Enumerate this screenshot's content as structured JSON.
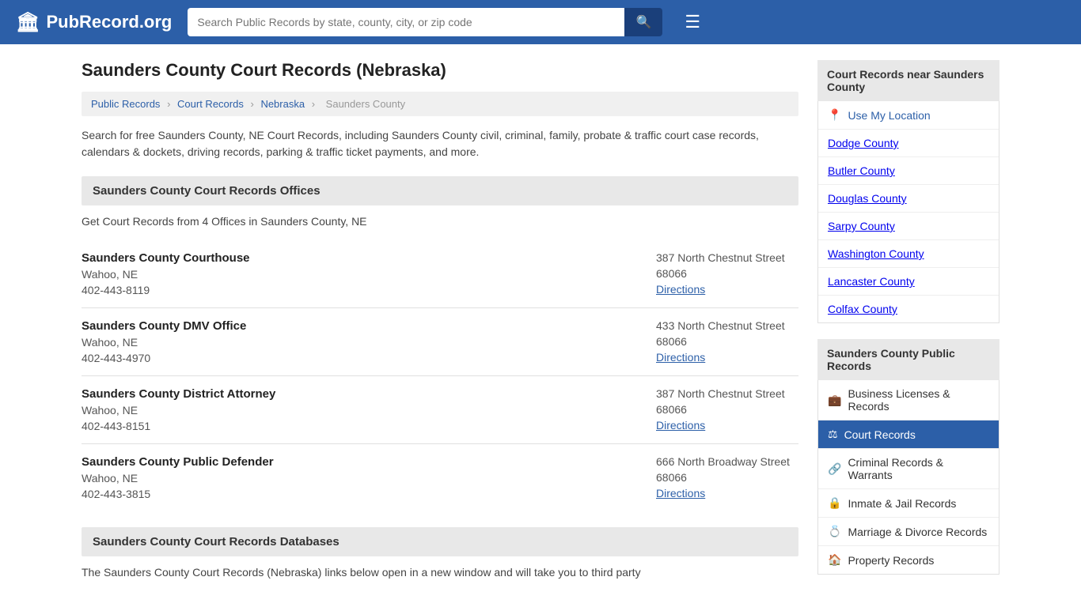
{
  "header": {
    "logo_icon": "🏛",
    "logo_text": "PubRecord.org",
    "search_placeholder": "Search Public Records by state, county, city, or zip code",
    "search_icon": "🔍"
  },
  "page": {
    "title": "Saunders County Court Records (Nebraska)",
    "description": "Search for free Saunders County, NE Court Records, including Saunders County civil, criminal, family, probate & traffic court case records, calendars & dockets, driving records, parking & traffic ticket payments, and more."
  },
  "breadcrumb": {
    "items": [
      "Public Records",
      "Court Records",
      "Nebraska",
      "Saunders County"
    ]
  },
  "offices_section": {
    "header": "Saunders County Court Records Offices",
    "sub_description": "Get Court Records from 4 Offices in Saunders County, NE",
    "offices": [
      {
        "name": "Saunders County Courthouse",
        "city": "Wahoo, NE",
        "phone": "402-443-8119",
        "address": "387 North Chestnut Street",
        "zip": "68066",
        "directions_label": "Directions"
      },
      {
        "name": "Saunders County DMV Office",
        "city": "Wahoo, NE",
        "phone": "402-443-4970",
        "address": "433 North Chestnut Street",
        "zip": "68066",
        "directions_label": "Directions"
      },
      {
        "name": "Saunders County District Attorney",
        "city": "Wahoo, NE",
        "phone": "402-443-8151",
        "address": "387 North Chestnut Street",
        "zip": "68066",
        "directions_label": "Directions"
      },
      {
        "name": "Saunders County Public Defender",
        "city": "Wahoo, NE",
        "phone": "402-443-3815",
        "address": "666 North Broadway Street",
        "zip": "68066",
        "directions_label": "Directions"
      }
    ]
  },
  "databases_section": {
    "header": "Saunders County Court Records Databases",
    "description": "The Saunders County Court Records (Nebraska) links below open in a new window and will take you to third party"
  },
  "sidebar": {
    "nearby_header": "Court Records near Saunders County",
    "use_my_location": "Use My Location",
    "nearby_counties": [
      "Dodge County",
      "Butler County",
      "Douglas County",
      "Sarpy County",
      "Washington County",
      "Lancaster County",
      "Colfax County"
    ],
    "public_records_header": "Saunders County Public Records",
    "public_records_items": [
      {
        "icon": "💼",
        "label": "Business Licenses & Records",
        "active": false
      },
      {
        "icon": "⚖",
        "label": "Court Records",
        "active": true
      },
      {
        "icon": "🔗",
        "label": "Criminal Records & Warrants",
        "active": false
      },
      {
        "icon": "🔒",
        "label": "Inmate & Jail Records",
        "active": false
      },
      {
        "icon": "💍",
        "label": "Marriage & Divorce Records",
        "active": false
      },
      {
        "icon": "🏠",
        "label": "Property Records",
        "active": false
      }
    ]
  }
}
